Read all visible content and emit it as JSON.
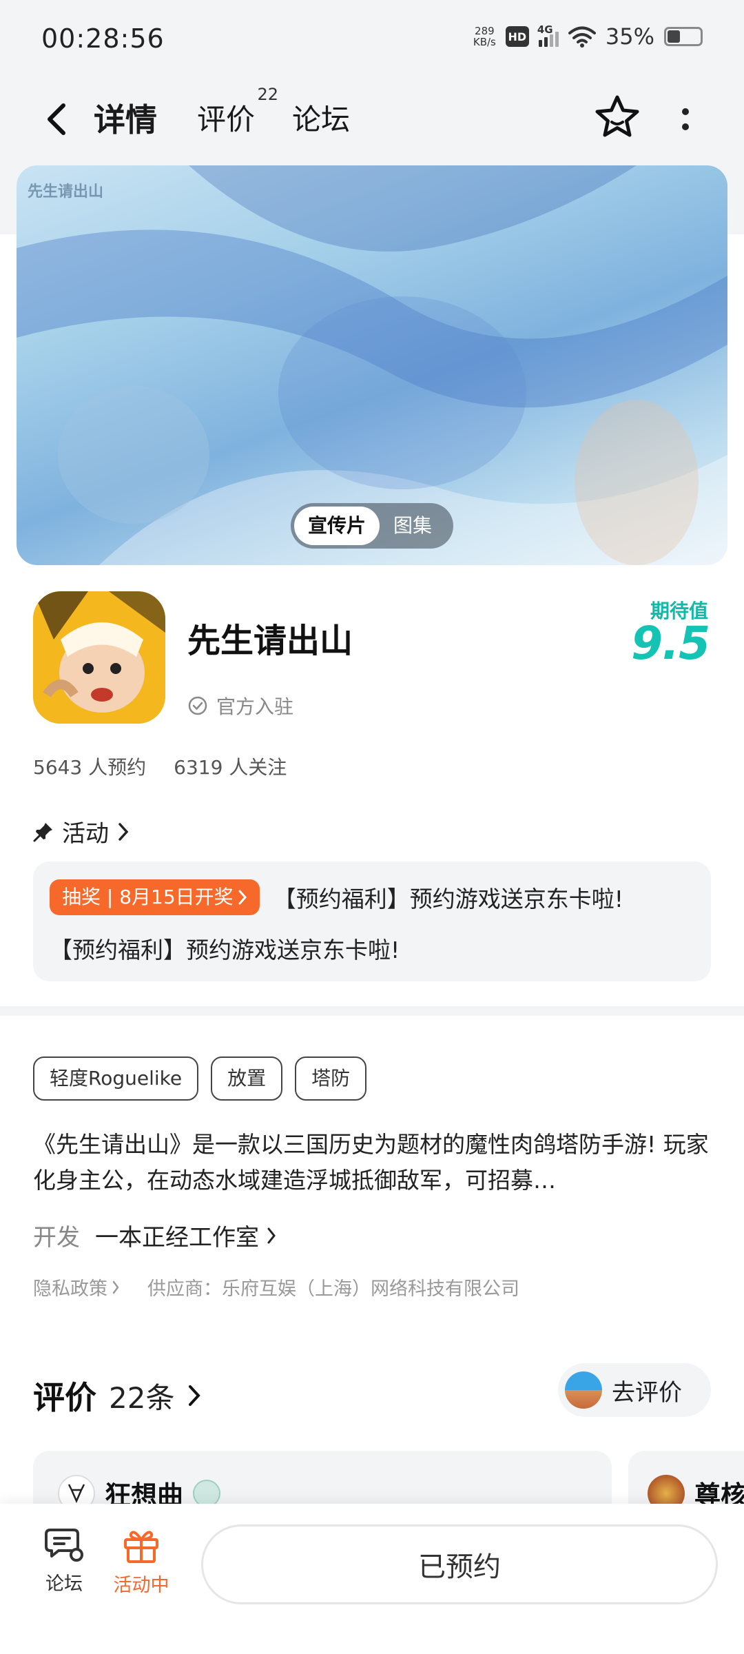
{
  "status_bar": {
    "time": "00:28:56",
    "net_speed_value": "289",
    "net_speed_unit": "KB/s",
    "hd_label": "HD",
    "network_type": "4G",
    "battery_percent": "35%",
    "battery_level": 0.35
  },
  "top_nav": {
    "tabs": [
      {
        "label": "详情",
        "active": true
      },
      {
        "label": "评价",
        "badge": "22"
      },
      {
        "label": "论坛"
      }
    ],
    "back_icon": "chevron-left-icon",
    "favorite_icon": "star-outline-icon",
    "more_icon": "more-vertical-icon"
  },
  "banner": {
    "watermark": "先生请出山",
    "media_options": [
      "宣传片",
      "图集"
    ],
    "active_option": "宣传片"
  },
  "app": {
    "name": "先生请出山",
    "official": "官方入驻",
    "expect_label": "期待值",
    "expect_score": "9.5",
    "reservations": "5643 人预约",
    "followers": "6319 人关注"
  },
  "activity": {
    "heading": "活动",
    "pill": "抽奖 | 8月15日开奖",
    "line1": "【预约福利】预约游戏送京东卡啦!",
    "line2": "【预约福利】预约游戏送京东卡啦!"
  },
  "info": {
    "tags": [
      "轻度Roguelike",
      "放置",
      "塔防"
    ],
    "description": "《先生请出山》是一款以三国历史为题材的魔性肉鸽塔防手游! 玩家化身主公，在动态水域建造浮城抵御敌军，可招募…",
    "dev_label": "开发",
    "dev_name": "一本正经工作室",
    "privacy": "隐私政策",
    "supplier": "供应商：乐府互娱（上海）网络科技有限公司"
  },
  "reviews": {
    "title": "评价",
    "count": "22条",
    "go_review": "去评价",
    "reviewer1": "狂想曲",
    "reviewer2": "尊核"
  },
  "bottom_bar": {
    "forum_label": "论坛",
    "activity_label": "活动中",
    "reserved_label": "已预约"
  },
  "colors": {
    "accent_teal": "#14c3b3",
    "accent_orange": "#f7692b",
    "page_bg": "#f3f4f6"
  }
}
